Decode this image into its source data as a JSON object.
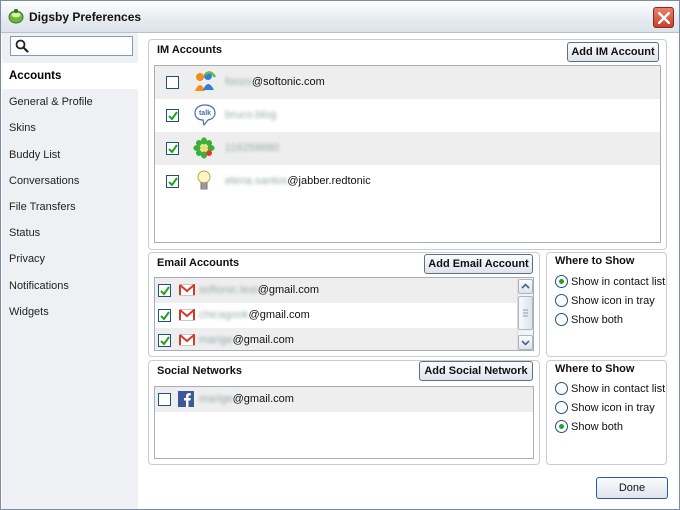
{
  "window": {
    "title": "Digsby Preferences"
  },
  "search": {
    "placeholder": ""
  },
  "sidebar": {
    "items": [
      {
        "label": "Accounts",
        "active": true
      },
      {
        "label": "General & Profile"
      },
      {
        "label": "Skins"
      },
      {
        "label": "Buddy List"
      },
      {
        "label": "Conversations"
      },
      {
        "label": "File Transfers"
      },
      {
        "label": "Status"
      },
      {
        "label": "Privacy"
      },
      {
        "label": "Notifications"
      },
      {
        "label": "Widgets"
      }
    ]
  },
  "im": {
    "title": "IM Accounts",
    "add_label": "Add IM Account",
    "accounts": [
      {
        "service": "msn-icon",
        "checked": false,
        "hidden": "fonzo",
        "suffix": "@softonic.com"
      },
      {
        "service": "google-talk-icon",
        "checked": true,
        "hidden": "bruco.blog",
        "suffix": ""
      },
      {
        "service": "icq-icon",
        "checked": true,
        "hidden": "116259680",
        "suffix": ""
      },
      {
        "service": "jabber-icon",
        "checked": true,
        "hidden": "elena.santos",
        "suffix": "@jabber.redtonic"
      }
    ]
  },
  "email": {
    "title": "Email Accounts",
    "add_label": "Add Email Account",
    "accounts": [
      {
        "service": "gmail-icon",
        "checked": true,
        "hidden": "softonic.test",
        "suffix": "@gmail.com"
      },
      {
        "service": "gmail-icon",
        "checked": true,
        "hidden": "chicagook",
        "suffix": "@gmail.com"
      },
      {
        "service": "gmail-icon",
        "checked": true,
        "hidden": "marige",
        "suffix": "@gmail.com"
      }
    ]
  },
  "social": {
    "title": "Social Networks",
    "add_label": "Add Social Network",
    "accounts": [
      {
        "service": "facebook-icon",
        "checked": false,
        "hidden": "marige",
        "suffix": "@gmail.com"
      }
    ]
  },
  "where_email": {
    "title": "Where to Show",
    "options": [
      "Show in contact list",
      "Show icon in tray",
      "Show both"
    ],
    "selected": 0
  },
  "where_social": {
    "title": "Where to Show",
    "options": [
      "Show in contact list",
      "Show icon in tray",
      "Show both"
    ],
    "selected": 2
  },
  "footer": {
    "done_label": "Done"
  },
  "colors": {
    "accent_green": "#21a121",
    "border_blue": "#1c5180",
    "sidebar_bg": "#eef0f3"
  }
}
